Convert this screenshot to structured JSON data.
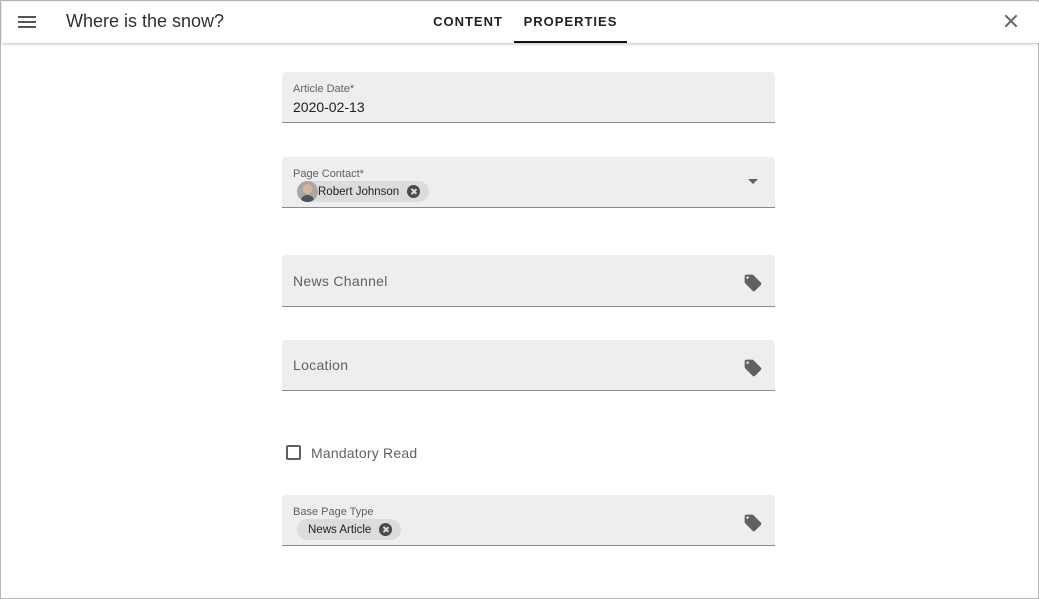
{
  "header": {
    "title": "Where is the snow?",
    "tabs": [
      {
        "label": "CONTENT",
        "active": false
      },
      {
        "label": "PROPERTIES",
        "active": true
      }
    ]
  },
  "form": {
    "article_date": {
      "label": "Article Date*",
      "value": "2020-02-13"
    },
    "page_contact": {
      "label": "Page Contact*",
      "chip": "Robert Johnson"
    },
    "news_channel": {
      "placeholder": "News Channel"
    },
    "location": {
      "placeholder": "Location"
    },
    "mandatory_read": {
      "label": "Mandatory Read",
      "checked": false
    },
    "base_page_type": {
      "label": "Base Page Type",
      "chip": "News Article"
    }
  },
  "colors": {
    "field_background": "#eeeeee",
    "tab_indicator": "#111111",
    "icon": "#616161"
  },
  "icons": [
    "menu-icon",
    "close-icon",
    "chip-remove-icon",
    "dropdown-arrow-icon",
    "tag-icon"
  ]
}
